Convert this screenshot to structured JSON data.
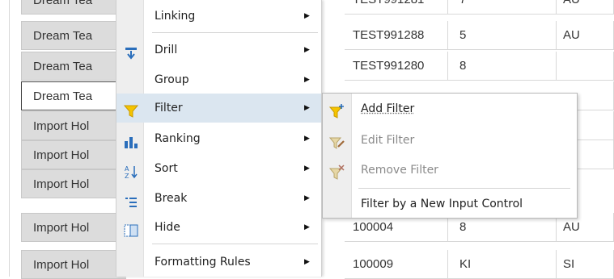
{
  "table": {
    "rows": [
      {
        "name": "Dream Tea",
        "col2": "TEST991281",
        "col3": "7",
        "col4": "AU",
        "partial": true
      },
      {
        "name": "Dream Tea",
        "col2": "TEST991288",
        "col3": "5",
        "col4": "AU"
      },
      {
        "name": "Dream Tea",
        "col2": "TEST991280",
        "col3": "8",
        "col4": ""
      },
      {
        "name": "Dream Tea",
        "col2": "",
        "col3": "",
        "col4": "",
        "selected": true
      },
      {
        "name": "Import Hol",
        "col2": "",
        "col3": "",
        "col4": "U"
      },
      {
        "name": "Import Hol",
        "col2": "",
        "col3": "",
        "col4": "U"
      },
      {
        "name": "Import Hol",
        "col2": "",
        "col3": "",
        "col4": ""
      },
      {
        "name": "Import Hol",
        "col2": "100004",
        "col3": "8",
        "col4": "AU"
      },
      {
        "name": "Import Hol",
        "col2": "100009",
        "col3": "KI",
        "col4": "SI"
      }
    ]
  },
  "menu": {
    "items": [
      {
        "label": "Linking",
        "icon": "none",
        "has_submenu": true
      },
      {
        "label": "Drill",
        "icon": "drill-icon",
        "has_submenu": true
      },
      {
        "label": "Group",
        "icon": "none",
        "has_submenu": true
      },
      {
        "label": "Filter",
        "icon": "filter-icon",
        "has_submenu": true,
        "highlighted": true
      },
      {
        "label": "Ranking",
        "icon": "ranking-icon",
        "has_submenu": true
      },
      {
        "label": "Sort",
        "icon": "sort-az-icon",
        "has_submenu": true
      },
      {
        "label": "Break",
        "icon": "break-icon",
        "has_submenu": true
      },
      {
        "label": "Hide",
        "icon": "hide-icon",
        "has_submenu": true
      },
      {
        "label": "Formatting Rules",
        "icon": "none",
        "has_submenu": true
      }
    ],
    "arrow": "▶"
  },
  "submenu": {
    "items": [
      {
        "label": "Add Filter",
        "icon": "add-filter-icon",
        "enabled": true
      },
      {
        "label": "Edit Filter",
        "icon": "edit-filter-icon",
        "enabled": false
      },
      {
        "label": "Remove Filter",
        "icon": "remove-filter-icon",
        "enabled": false
      },
      {
        "label": "Filter by a New Input Control",
        "icon": "none",
        "enabled": true
      }
    ]
  },
  "colors": {
    "highlight": "#dbe6f0",
    "filter_yellow": "#f5c400",
    "icon_blue": "#2a6ebb",
    "disabled_text": "#8a8a8a"
  }
}
